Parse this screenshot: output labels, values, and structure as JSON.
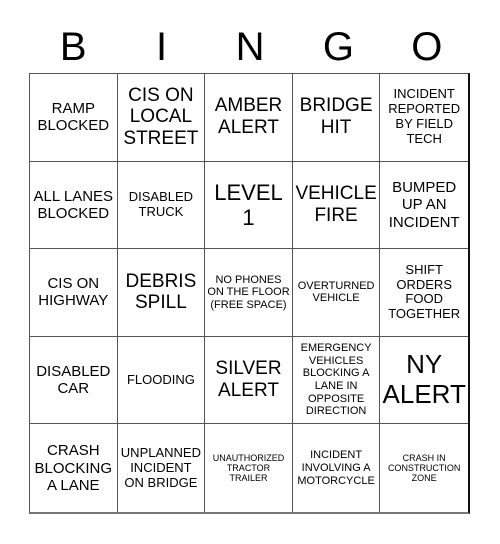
{
  "header": {
    "letters": [
      "B",
      "I",
      "N",
      "G",
      "O"
    ]
  },
  "cells": [
    [
      "RAMP BLOCKED",
      "CIS ON LOCAL STREET",
      "AMBER ALERT",
      "BRIDGE HIT",
      "INCIDENT REPORTED BY FIELD TECH"
    ],
    [
      "ALL LANES BLOCKED",
      "DISABLED TRUCK",
      "LEVEL 1",
      "VEHICLE FIRE",
      "BUMPED UP AN INCIDENT"
    ],
    [
      "CIS ON HIGHWAY",
      "DEBRIS SPILL",
      "NO PHONES ON THE FLOOR (FREE SPACE)",
      "OVERTURNED VEHICLE",
      "SHIFT ORDERS FOOD TOGETHER"
    ],
    [
      "DISABLED CAR",
      "FLOODING",
      "SILVER ALERT",
      "EMERGENCY VEHICLES BLOCKING A LANE IN OPPOSITE DIRECTION",
      "NY ALERT"
    ],
    [
      "CRASH BLOCKING A LANE",
      "UNPLANNED INCIDENT ON BRIDGE",
      "UNAUTHORIZED TRACTOR TRAILER",
      "INCIDENT INVOLVING A MOTORCYCLE",
      "CRASH IN CONSTRUCTION ZONE"
    ]
  ]
}
